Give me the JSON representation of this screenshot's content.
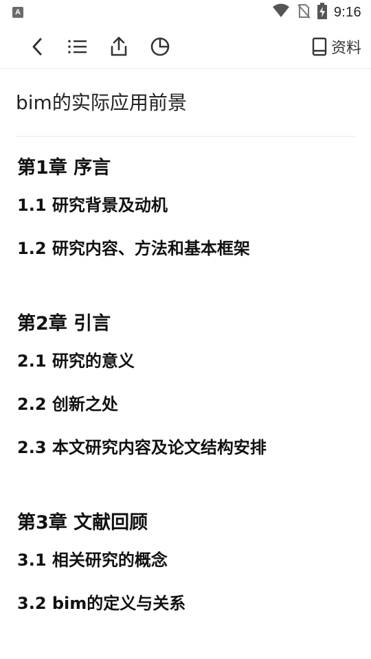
{
  "status_bar": {
    "app_badge": "A",
    "time": "9:16"
  },
  "toolbar": {
    "back_icon": "chevron-left-icon",
    "toc_icon": "list-icon",
    "share_icon": "share-icon",
    "stats_icon": "pie-chart-icon",
    "resource_icon": "book-icon",
    "resource_label": "资料"
  },
  "document": {
    "title": "bim的实际应用前景"
  },
  "toc": [
    {
      "chapter": "第1章 序言",
      "sections": [
        "1.1 研究背景及动机",
        "1.2 研究内容、方法和基本框架"
      ]
    },
    {
      "chapter": "第2章 引言",
      "sections": [
        "2.1 研究的意义",
        "2.2 创新之处",
        "2.3 本文研究内容及论文结构安排"
      ]
    },
    {
      "chapter": "第3章 文献回顾",
      "sections": [
        "3.1 相关研究的概念",
        "3.2 bim的定义与关系"
      ]
    }
  ]
}
